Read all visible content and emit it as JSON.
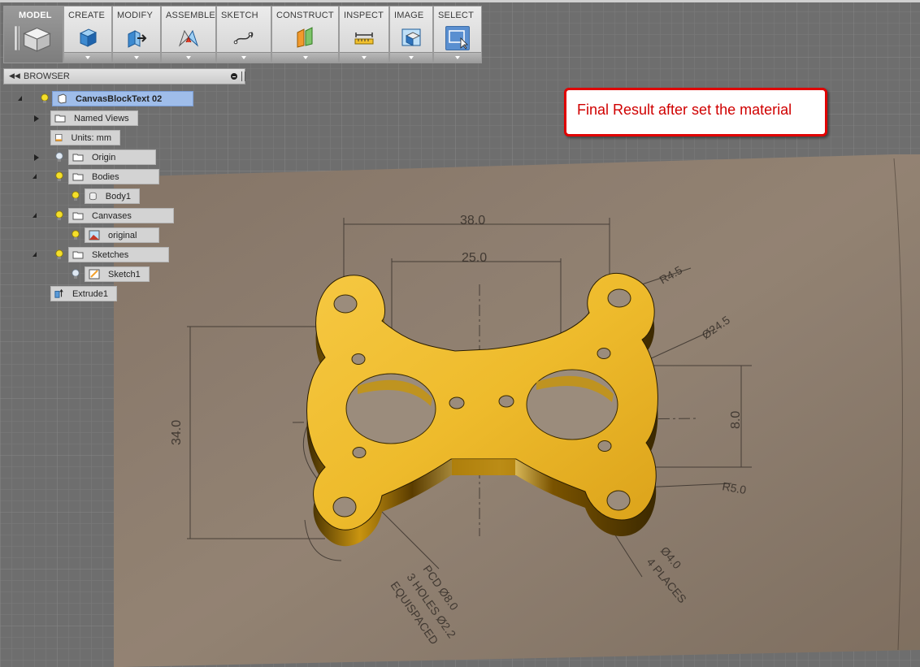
{
  "toolbar": {
    "groups": [
      {
        "id": "model",
        "label": "MODEL"
      },
      {
        "id": "create",
        "label": "CREATE"
      },
      {
        "id": "modify",
        "label": "MODIFY"
      },
      {
        "id": "assemble",
        "label": "ASSEMBLE"
      },
      {
        "id": "sketch",
        "label": "SKETCH"
      },
      {
        "id": "construct",
        "label": "CONSTRUCT"
      },
      {
        "id": "inspect",
        "label": "INSPECT"
      },
      {
        "id": "image",
        "label": "IMAGE"
      },
      {
        "id": "select",
        "label": "SELECT"
      }
    ]
  },
  "browser": {
    "title": "BROWSER",
    "root": "CanvasBlockText 02",
    "items": [
      {
        "label": "Named Views"
      },
      {
        "label": "Units: mm"
      },
      {
        "label": "Origin"
      },
      {
        "label": "Bodies"
      },
      {
        "label": "Body1"
      },
      {
        "label": "Canvases"
      },
      {
        "label": "original"
      },
      {
        "label": "Sketches"
      },
      {
        "label": "Sketch1"
      },
      {
        "label": "Extrude1"
      }
    ]
  },
  "callout": {
    "text": "Final Result after set the material"
  },
  "drawing": {
    "dims": [
      "38.0",
      "25.0",
      "R4.5",
      "Ø24.5",
      "34.0",
      "8.0",
      "R5.0",
      "Ø4.0",
      "4 PLACES",
      "PCD Ø8.0",
      "3 HOLES Ø2.2",
      "EQUISPACED"
    ]
  },
  "colors": {
    "gold": "#e6b21e",
    "callout_border": "#e00000",
    "selected_node": "#9fbdea"
  }
}
